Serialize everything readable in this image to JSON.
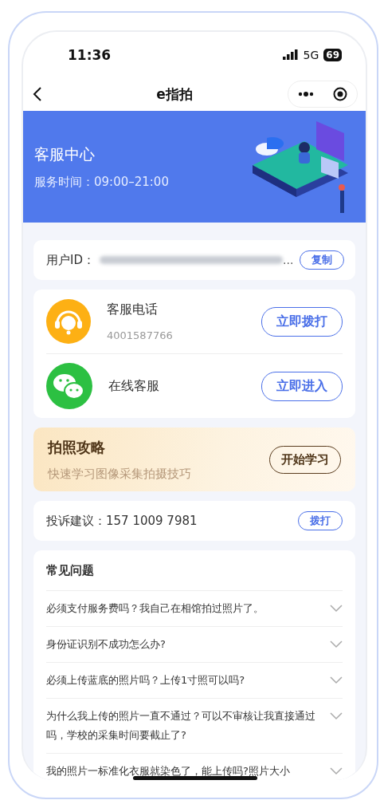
{
  "status_bar": {
    "time": "11:36",
    "network": "5G",
    "battery": "69"
  },
  "nav": {
    "title": "e指拍"
  },
  "banner": {
    "title": "客服中心",
    "subtitle": "服务时间：09:00–21:00"
  },
  "user_id": {
    "label": "用户ID：",
    "ellipsis": "...",
    "button": "复制"
  },
  "contacts": [
    {
      "kind": "phone",
      "title": "客服电话",
      "detail": "4001587766",
      "button": "立即拨打"
    },
    {
      "kind": "chat",
      "title": "在线客服",
      "button": "立即进入"
    }
  ],
  "guide": {
    "title": "拍照攻略",
    "subtitle": "快速学习图像采集拍摄技巧",
    "button": "开始学习"
  },
  "complaint": {
    "text": "投诉建议：157 1009 7981",
    "button": "拨打"
  },
  "faq": {
    "title": "常见问题",
    "items": [
      {
        "question": "必须支付服务费吗？我自己在相馆拍过照片了。",
        "expanded": false
      },
      {
        "question": "身份证识别不成功怎么办?",
        "expanded": false
      },
      {
        "question": "必须上传蓝底的照片吗？上传1寸照可以吗?",
        "expanded": false
      },
      {
        "question": "为什么我上传的照片一直不通过？可以不审核让我直接通过吗，学校的采集时间要截止了?",
        "expanded": false
      },
      {
        "question": "我的照片一标准化衣服就染色了，能上传吗?照片大小",
        "expanded": false
      }
    ]
  }
}
